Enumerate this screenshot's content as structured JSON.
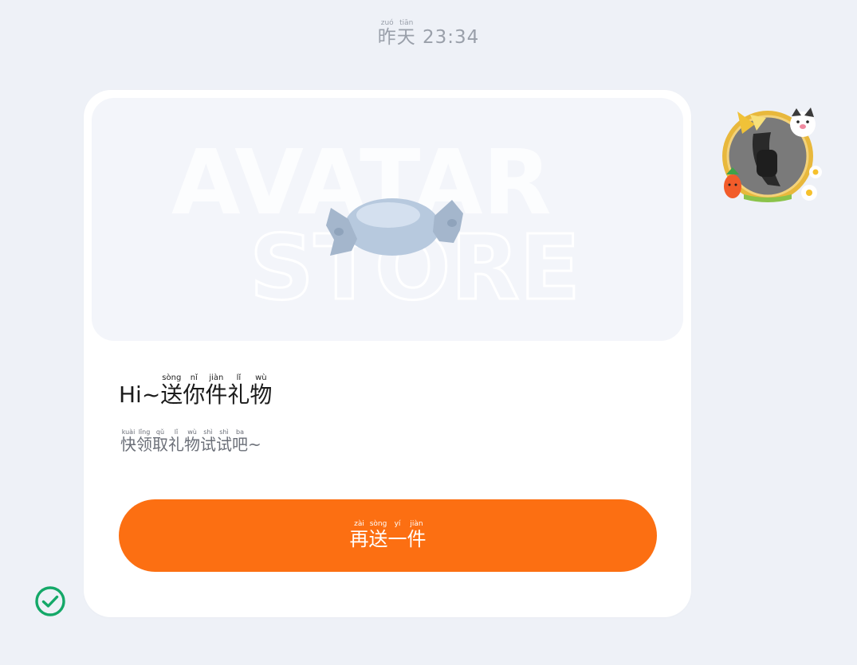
{
  "timestamp": {
    "day_chars": [
      "昨",
      "天"
    ],
    "day_pinyin": [
      "zuó",
      "tiān"
    ],
    "time": "23:34"
  },
  "gift_card": {
    "banner_watermark_line1": "AVATAR",
    "banner_watermark_line2": "STORE",
    "greeting_prefix": "Hi~",
    "title_chars": [
      "送",
      "你",
      "件",
      "礼",
      "物"
    ],
    "title_pinyin": [
      "sòng",
      "nǐ",
      "jiàn",
      "lǐ",
      "wù"
    ],
    "subtitle_chars": [
      "快",
      "领",
      "取",
      "礼",
      "物",
      "试",
      "试",
      "吧"
    ],
    "subtitle_pinyin": [
      "kuài",
      "lǐng",
      "qǔ",
      "lǐ",
      "wù",
      "shì",
      "shì",
      "ba"
    ],
    "subtitle_suffix": "~",
    "button_chars": [
      "再",
      "送",
      "一",
      "件"
    ],
    "button_pinyin": [
      "zài",
      "sòng",
      "yí",
      "jiàn"
    ]
  },
  "icons": {
    "avatar": "user-avatar",
    "status": "check-circle-icon"
  },
  "colors": {
    "background": "#eef1f7",
    "card": "#ffffff",
    "banner": "#f3f5fa",
    "button": "#fc6f12",
    "check": "#14a868",
    "timestamp": "#9aa0aa"
  }
}
